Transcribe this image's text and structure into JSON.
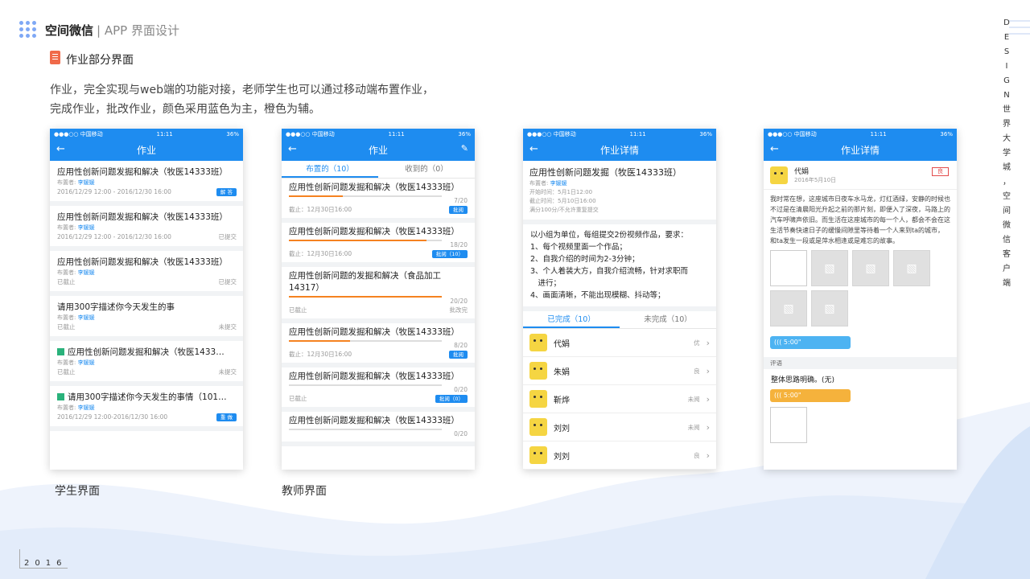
{
  "header": {
    "brand": "空间微信",
    "subtitle": "| APP 界面设计"
  },
  "section": {
    "title": "作业部分界面"
  },
  "description": {
    "line1": "作业，完全实现与web端的功能对接，老师学生也可以通过移动端布置作业，",
    "line2": "完成作业，批改作业，颜色采用蓝色为主，橙色为辅。"
  },
  "side": {
    "letters": [
      "D",
      "E",
      "S",
      "I",
      "G",
      "N",
      "世",
      "界",
      "大",
      "学",
      "城",
      "，",
      "空",
      "间",
      "微",
      "信",
      "客",
      "户",
      "端"
    ]
  },
  "footer": {
    "year": "2016"
  },
  "captions": {
    "student": "学生界面",
    "teacher": "教师界面"
  },
  "colors": {
    "primary": "#1e8cf0",
    "accent": "#f58220",
    "green": "#2ab27b"
  },
  "status": {
    "carrier": "●●●○○ 中国移动 ",
    "time": "11:11",
    "battery": "36%"
  },
  "phone1": {
    "title": "作业",
    "items": [
      {
        "title": "应用性创新问题发掘和解决（牧医14333班）",
        "setter_label": "布置者:",
        "setter": "李媛媛",
        "time": "2016/12/29 12:00 - 2016/12/30 16:00",
        "status": "解 答",
        "badge": true,
        "icon": false
      },
      {
        "title": "应用性创新问题发掘和解决（牧医14333班）",
        "setter_label": "布置者:",
        "setter": "李媛媛",
        "time": "2016/12/29 12:00 - 2016/12/30 16:00",
        "status": "已提交",
        "badge": false,
        "icon": false
      },
      {
        "title": "应用性创新问题发掘和解决（牧医14333班）",
        "setter_label": "布置者:",
        "setter": "李媛媛",
        "time": "已截止",
        "status": "已提交",
        "badge": false,
        "icon": false
      },
      {
        "title": "请用300字描述你今天发生的事",
        "setter_label": "布置者:",
        "setter": "李媛媛",
        "time": "已截止",
        "status": "未提交",
        "badge": false,
        "icon": false
      },
      {
        "title": "应用性创新问题发掘和解决（牧医1433…",
        "setter_label": "布置者:",
        "setter": "李媛媛",
        "time": "已截止",
        "status": "未提交",
        "badge": false,
        "icon": true
      },
      {
        "title": "请用300字描述你今天发生的事情（101…",
        "setter_label": "布置者:",
        "setter": "李媛媛",
        "time": "2016/12/29 12:00-2016/12/30 16:00",
        "status": "重 做",
        "badge": true,
        "icon": true
      }
    ]
  },
  "phone2": {
    "title": "作业",
    "tab_assigned": "布置的（10）",
    "tab_received": "收到的（0）",
    "items": [
      {
        "title": "应用性创新问题发掘和解决（牧医14333班）",
        "count": "7/20",
        "progress": 0.35,
        "deadline": "截止：12月30日16:00",
        "action": "批阅",
        "badge": true
      },
      {
        "title": "应用性创新问题发掘和解决（牧医14333班）",
        "count": "18/20",
        "progress": 0.9,
        "deadline": "截止：12月30日16:00",
        "action": "批阅（10）",
        "badge": true
      },
      {
        "title": "应用性创新问题的发掘和解决（食品加工14317）",
        "count": "20/20",
        "progress": 1.0,
        "deadline": "已截止",
        "action": "批改完",
        "badge": false
      },
      {
        "title": "应用性创新问题发掘和解决（牧医14333班）",
        "count": "8/20",
        "progress": 0.4,
        "deadline": "截止：12月30日16:00",
        "action": "批阅",
        "badge": true
      },
      {
        "title": "应用性创新问题发掘和解决（牧医14333班）",
        "count": "0/20",
        "progress": 0,
        "deadline": "已截止",
        "action": "批阅（0）",
        "badge": true
      },
      {
        "title": "应用性创新问题发掘和解决（牧医14333班）",
        "count": "0/20",
        "progress": 0,
        "deadline": "",
        "action": "",
        "badge": false
      }
    ]
  },
  "phone3": {
    "title": "作业详情",
    "task_title": "应用性创新问题发掘（牧医14333班）",
    "setter_label": "布置者:",
    "setter": "李媛媛",
    "start": "开始时间：5月1日12:00",
    "end": "截止时间：5月10日16:00",
    "score": "满分100分/不允许重复提交",
    "requirements": [
      "以小组为单位，每组提交2份视频作品，要求：",
      "1、每个视频里面一个作品；",
      "2、自我介绍的时间为2-3分钟；",
      "3、个人着装大方，自我介绍流畅，针对求职而",
      "　进行；",
      "4、画面清晰，不能出现模糊、抖动等；"
    ],
    "tab_done": "已完成（10）",
    "tab_undone": "未完成（10）",
    "students": [
      {
        "name": "代娟",
        "grade": "优"
      },
      {
        "name": "朱娟",
        "grade": "良"
      },
      {
        "name": "靳烨",
        "grade": "未阅"
      },
      {
        "name": "刘刘",
        "grade": "未阅"
      },
      {
        "name": "刘刘",
        "grade": "良"
      }
    ]
  },
  "phone4": {
    "title": "作业详情",
    "name": "代娟",
    "date": "2016年5月10日",
    "grade": "良",
    "text": "我时常在想，这座城市日夜车水马龙，灯红酒绿，安静的时候也不过是在清晨阳光升起之前的那片刻，即便入了深夜，马路上的汽车呼啸声依旧。而生活在这座城市的每一个人，都会不会在这生活节奏快速日子的缓慢间隙里等待着一个人来到ta的城市，和ta发生一段或是萍水相逢或是难忘的故事。",
    "voice1": "((( 5:00\"",
    "comment_header": "评语",
    "comment": "整体思路明确。(无)",
    "voice2": "((( 5:00\""
  }
}
